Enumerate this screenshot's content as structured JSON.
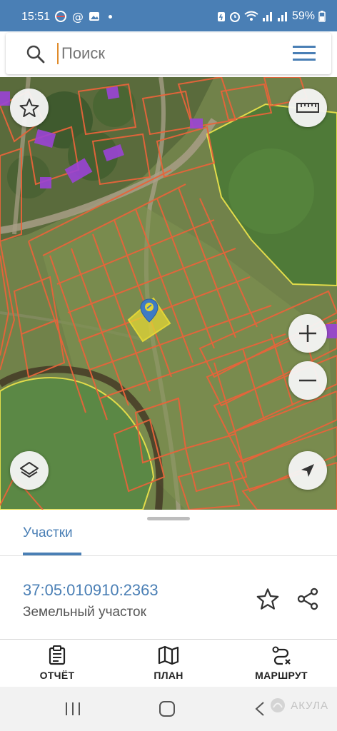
{
  "status_bar": {
    "time": "15:51",
    "battery": "59%"
  },
  "search": {
    "placeholder": "Поиск"
  },
  "bottom_sheet": {
    "tab_label": "Участки",
    "parcel_id": "37:05:010910:2363",
    "parcel_type": "Земельный участок"
  },
  "actions": [
    {
      "label": "ОТЧЁТ",
      "icon": "report-icon"
    },
    {
      "label": "ПЛАН",
      "icon": "map-plan-icon"
    },
    {
      "label": "МАРШРУТ",
      "icon": "route-icon"
    }
  ],
  "watermark": "АКУЛА",
  "colors": {
    "accent": "#4a7fb5",
    "parcel_lines": "#e8643a",
    "selected_parcel": "#e3d636",
    "buildings": "#9b44d6",
    "forest_outline": "#e2dc4a"
  }
}
